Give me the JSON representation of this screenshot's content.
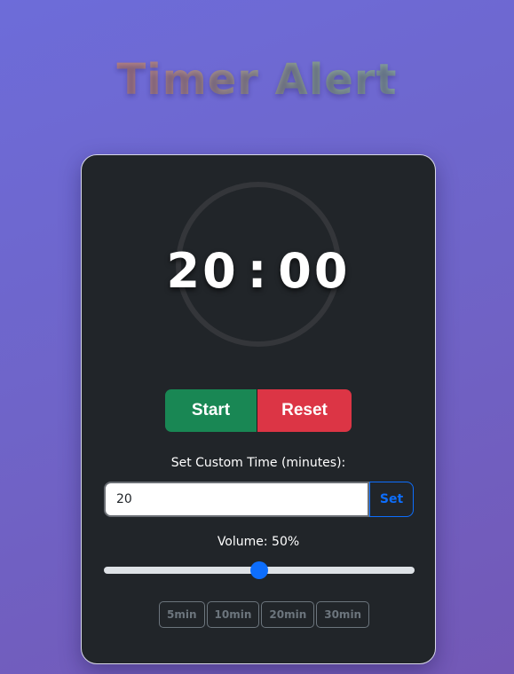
{
  "app": {
    "title": "Timer Alert"
  },
  "timer": {
    "minutes": "20",
    "separator": ":",
    "seconds": "00"
  },
  "controls": {
    "start_label": "Start",
    "reset_label": "Reset"
  },
  "custom_time": {
    "label": "Set Custom Time (minutes):",
    "value": "20",
    "set_label": "Set"
  },
  "volume": {
    "label": "Volume: 50%",
    "level": 0.5
  },
  "presets": [
    {
      "label": "5min"
    },
    {
      "label": "10min"
    },
    {
      "label": "20min"
    },
    {
      "label": "30min"
    }
  ],
  "colors": {
    "start": "#198754",
    "reset": "#dc3545",
    "accent": "#0d6efd",
    "card": "#212529"
  }
}
